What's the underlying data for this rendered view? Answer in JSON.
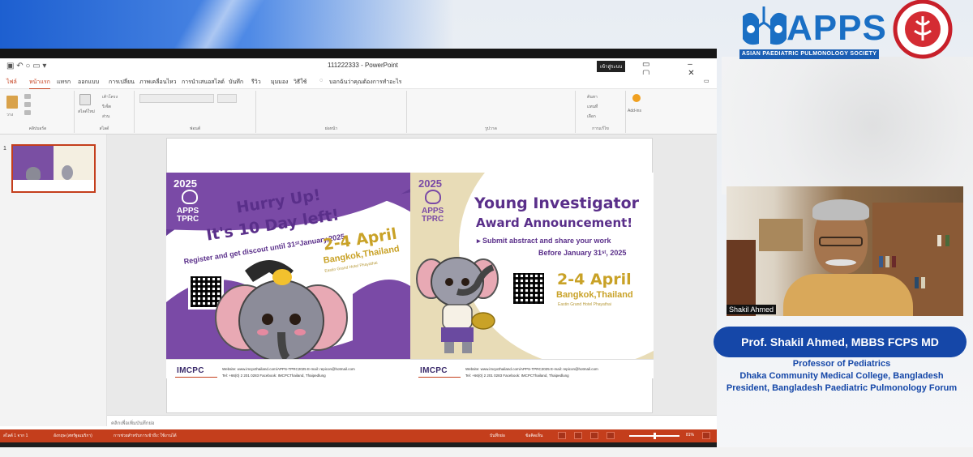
{
  "window": {
    "title": "111222333  -  PowerPoint",
    "signin_label": "เข้าสู่ระบบ",
    "menu_tabs": [
      {
        "label": "ไฟล์"
      },
      {
        "label": "หน้าแรก"
      },
      {
        "label": "แทรก"
      },
      {
        "label": "ออกแบบ"
      },
      {
        "label": "การเปลี่ยน"
      },
      {
        "label": "ภาพเคลื่อนไหว"
      },
      {
        "label": "การนำเสนอสไลด์"
      },
      {
        "label": "บันทึก"
      },
      {
        "label": "รีวิว"
      },
      {
        "label": "มุมมอง"
      },
      {
        "label": "วิธีใช้"
      }
    ],
    "tell_me": "บอกฉันว่าคุณต้องการทำอะไร",
    "ribbon_groups": [
      "คลิปบอร์ด",
      "สไลด์",
      "ฟอนต์",
      "ย่อหน้า",
      "รูปวาด",
      "การแก้ไข"
    ],
    "ribbon_labels": {
      "paste": "วาง",
      "new_slide": "สไลด์ใหม่",
      "layout": "เค้าโครง",
      "reset": "รีเซ็ต",
      "section": "ส่วน",
      "find": "ค้นหา",
      "replace": "แทนที่",
      "select": "เลือก",
      "addins": "Add-ins"
    },
    "slide_number": "1",
    "notes_placeholder": "คลิกเพื่อเพิ่มบันทึกย่อ",
    "status": {
      "slide_info": "สไลด์ 1 จาก 1",
      "language": "อังกฤษ (สหรัฐอเมริกา)",
      "accessibility": "การช่วยสำหรับการเข้าถึง: ใช้งานได้",
      "notes": "บันทึกย่อ",
      "comments": "ข้อคิดเห็น",
      "zoom": "81%"
    }
  },
  "logo": {
    "apps_text": "APPS",
    "apps_subtitle": "ASIAN PAEDIATRIC PULMONOLOGY SOCIETY"
  },
  "poster_left": {
    "year": "2025",
    "tag_line1": "APPS",
    "tag_line2": "TPRC",
    "headline1": "Hurry Up!",
    "headline2": "It's 10 Day left!",
    "register": "Register and get discout until 31ˢᵗJanuary,2025",
    "date": "2-4 April",
    "city": "Bangkok,Thailand",
    "hotel": "Eastin Grand Hotel Phayathai",
    "footer_org": "IMCPC",
    "footer_line1": "Website: www.imcpcthailand.com/APPS-TPRC2025  E-mail: repicon@hotmail.com",
    "footer_line2": "Tel: +66(0) 2 201 0283  Facebook: IMCPCThailand, Thaipedlung"
  },
  "poster_right": {
    "year": "2025",
    "tag_line1": "APPS",
    "tag_line2": "TPRC",
    "headline1": "Young Investigator",
    "headline2": "Award Announcement!",
    "sub1": "▸ Submit abstract and share your work",
    "sub2": "Before January 31ˢᵗ, 2025",
    "date": "2-4 April",
    "city": "Bangkok,Thailand",
    "hotel": "Eastin Grand Hotel Phayathai",
    "footer_org": "IMCPC",
    "footer_line1": "Website: www.imcpcthailand.com/APPS-TPRC2025  E-mail: repicon@hotmail.com",
    "footer_line2": "Tel: +66(0) 2 201 0283  Facebook: IMCPCThailand, Thaipedlung"
  },
  "speaker": {
    "video_name": "Shakil Ahmed",
    "banner": "Prof. Shakil Ahmed, MBBS FCPS MD",
    "line1": "Professor of Pediatrics",
    "line2": "Dhaka Community Medical College, Bangladesh",
    "line3": "President, Bangladesh Paediatric Pulmonology Forum"
  },
  "colors": {
    "ppt_accent": "#c43e1c",
    "poster_purple": "#5a2f8a",
    "poster_gold": "#c9a227",
    "apps_blue": "#1a6fc4",
    "banner_blue": "#1547a8"
  }
}
